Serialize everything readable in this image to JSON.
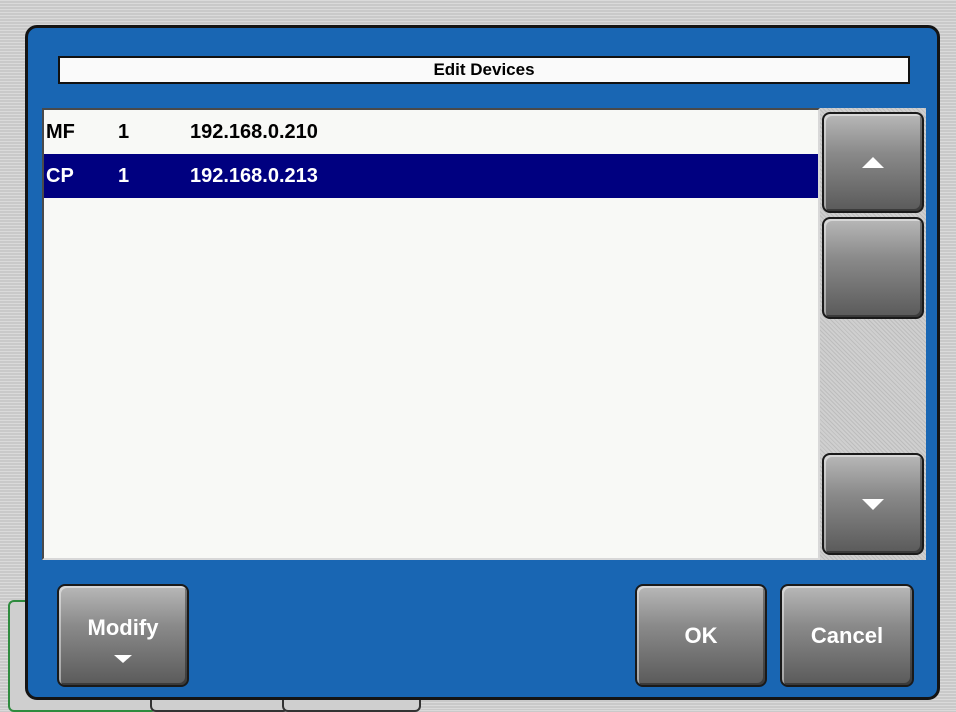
{
  "dialog": {
    "title": "Edit Devices"
  },
  "devices": [
    {
      "type": "MF",
      "number": "1",
      "ip": "192.168.0.210",
      "selected": false
    },
    {
      "type": "CP",
      "number": "1",
      "ip": "192.168.0.213",
      "selected": true
    }
  ],
  "scrollbar": {
    "up_icon": "arrow-up-icon",
    "down_icon": "arrow-down-icon"
  },
  "buttons": {
    "modify_label": "Modify",
    "modify_icon": "chevron-down-icon",
    "ok_label": "OK",
    "cancel_label": "Cancel"
  },
  "colors": {
    "dialog_bg": "#1966b3",
    "selection_bg": "#000080",
    "list_bg": "#f8f9f6"
  }
}
